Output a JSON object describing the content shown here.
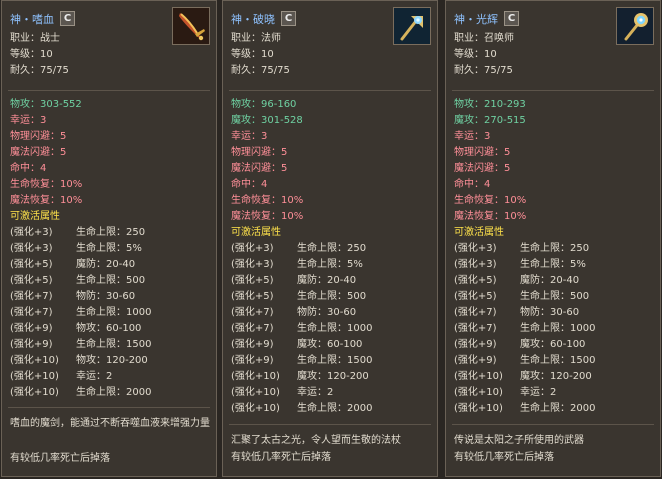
{
  "panels": [
    {
      "title": "神・嗜血",
      "badge": "C",
      "icon": "sword-icon",
      "basic": [
        "职业：战士",
        "等级：10",
        "耐久：75/75"
      ],
      "stats": [
        {
          "text": "物攻：303-552",
          "color": "green"
        },
        {
          "text": "幸运：3",
          "color": "pink"
        },
        {
          "text": "物理闪避：5",
          "color": "pink"
        },
        {
          "text": "魔法闪避：5",
          "color": "pink"
        },
        {
          "text": "命中：4",
          "color": "pink"
        },
        {
          "text": "生命恢复：10%",
          "color": "pink"
        },
        {
          "text": "魔法恢复：10%",
          "color": "pink"
        }
      ],
      "activatable_label": "可激活属性",
      "enhancements": [
        [
          "(强化+3)",
          "生命上限：250"
        ],
        [
          "(强化+3)",
          "生命上限：5%"
        ],
        [
          "(强化+5)",
          "魔防：20-40"
        ],
        [
          "(强化+5)",
          "生命上限：500"
        ],
        [
          "(强化+7)",
          "物防：30-60"
        ],
        [
          "(强化+7)",
          "生命上限：1000"
        ],
        [
          "(强化+9)",
          "物攻：60-100"
        ],
        [
          "(强化+9)",
          "生命上限：1500"
        ],
        [
          "(强化+10)",
          "物攻：120-200"
        ],
        [
          "(强化+10)",
          "幸运：2"
        ],
        [
          "(强化+10)",
          "生命上限：2000"
        ]
      ],
      "description": "嗜血的魔剑，能通过不断吞噬血液来增强力量",
      "drop": "有较低几率死亡后掉落"
    },
    {
      "title": "神・破晓",
      "badge": "C",
      "icon": "staff-icon",
      "basic": [
        "职业：法师",
        "等级：10",
        "耐久：75/75"
      ],
      "stats": [
        {
          "text": "物攻：96-160",
          "color": "green"
        },
        {
          "text": "魔攻：301-528",
          "color": "green"
        },
        {
          "text": "幸运：3",
          "color": "pink"
        },
        {
          "text": "物理闪避：5",
          "color": "pink"
        },
        {
          "text": "魔法闪避：5",
          "color": "pink"
        },
        {
          "text": "命中：4",
          "color": "pink"
        },
        {
          "text": "生命恢复：10%",
          "color": "pink"
        },
        {
          "text": "魔法恢复：10%",
          "color": "pink"
        }
      ],
      "activatable_label": "可激活属性",
      "enhancements": [
        [
          "(强化+3)",
          "生命上限：250"
        ],
        [
          "(强化+3)",
          "生命上限：5%"
        ],
        [
          "(强化+5)",
          "魔防：20-40"
        ],
        [
          "(强化+5)",
          "生命上限：500"
        ],
        [
          "(强化+7)",
          "物防：30-60"
        ],
        [
          "(强化+7)",
          "生命上限：1000"
        ],
        [
          "(强化+9)",
          "魔攻：60-100"
        ],
        [
          "(强化+9)",
          "生命上限：1500"
        ],
        [
          "(强化+10)",
          "魔攻：120-200"
        ],
        [
          "(强化+10)",
          "幸运：2"
        ],
        [
          "(强化+10)",
          "生命上限：2000"
        ]
      ],
      "description": "汇聚了太古之光，令人望而生敬的法杖",
      "drop": "有较低几率死亡后掉落"
    },
    {
      "title": "神・光辉",
      "badge": "C",
      "icon": "scepter-icon",
      "basic": [
        "职业：召唤师",
        "等级：10",
        "耐久：75/75"
      ],
      "stats": [
        {
          "text": "物攻：210-293",
          "color": "green"
        },
        {
          "text": "魔攻：270-515",
          "color": "green"
        },
        {
          "text": "幸运：3",
          "color": "pink"
        },
        {
          "text": "物理闪避：5",
          "color": "pink"
        },
        {
          "text": "魔法闪避：5",
          "color": "pink"
        },
        {
          "text": "命中：4",
          "color": "pink"
        },
        {
          "text": "生命恢复：10%",
          "color": "pink"
        },
        {
          "text": "魔法恢复：10%",
          "color": "pink"
        }
      ],
      "activatable_label": "可激活属性",
      "enhancements": [
        [
          "(强化+3)",
          "生命上限：250"
        ],
        [
          "(强化+3)",
          "生命上限：5%"
        ],
        [
          "(强化+5)",
          "魔防：20-40"
        ],
        [
          "(强化+5)",
          "生命上限：500"
        ],
        [
          "(强化+7)",
          "物防：30-60"
        ],
        [
          "(强化+7)",
          "生命上限：1000"
        ],
        [
          "(强化+9)",
          "魔攻：60-100"
        ],
        [
          "(强化+9)",
          "生命上限：1500"
        ],
        [
          "(强化+10)",
          "魔攻：120-200"
        ],
        [
          "(强化+10)",
          "幸运：2"
        ],
        [
          "(强化+10)",
          "生命上限：2000"
        ]
      ],
      "description": "传说是太阳之子所使用的武器",
      "drop": "有较低几率死亡后掉落"
    }
  ],
  "colors": {
    "title": "#8fc2ff",
    "green": "#6fd1a2",
    "pink": "#ff8f98",
    "yellow": "#ffe34b",
    "text": "#e1dbce"
  }
}
